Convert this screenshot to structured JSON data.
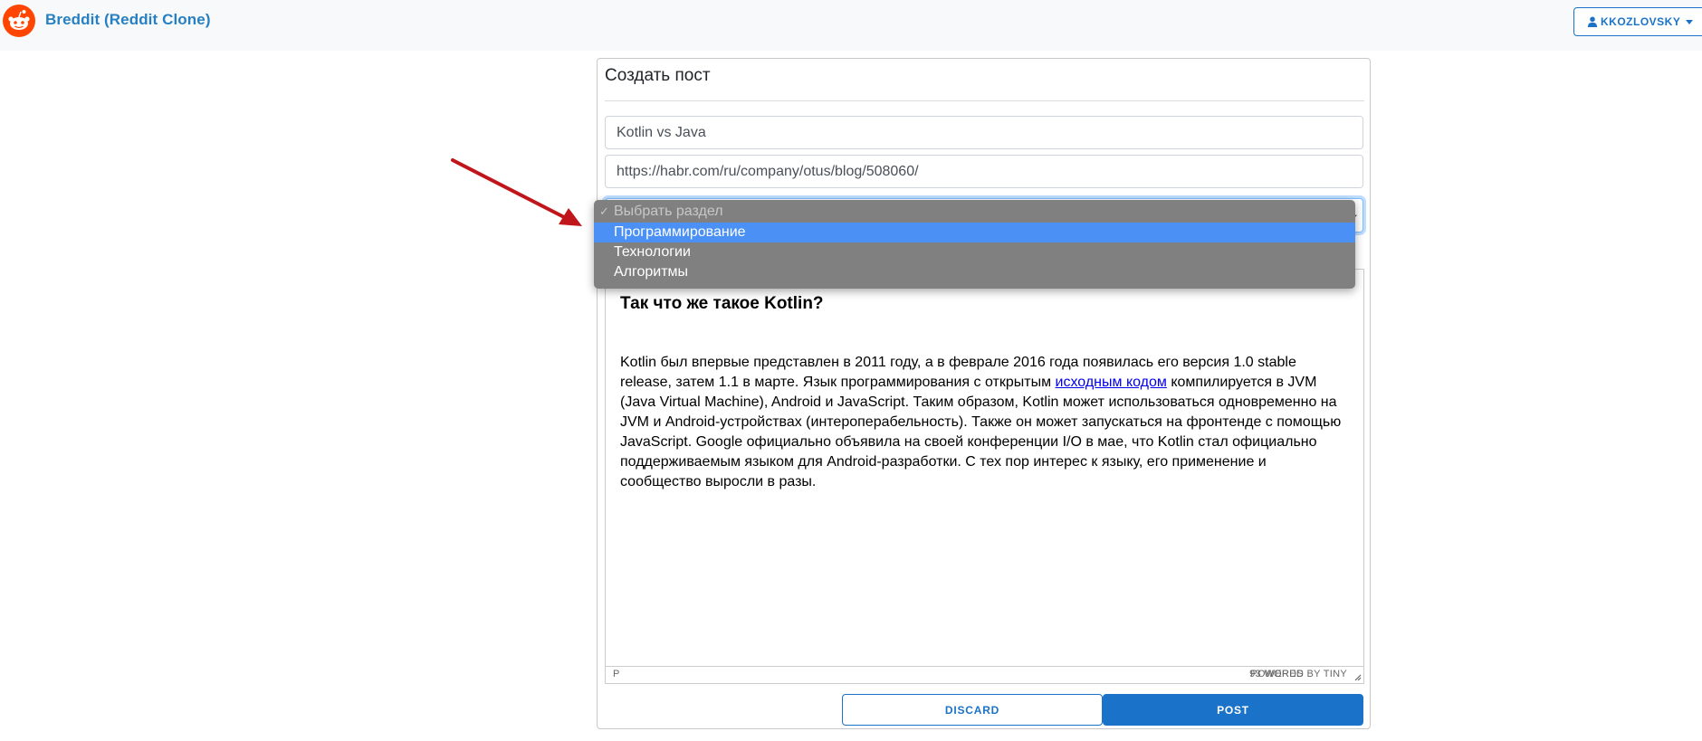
{
  "navbar": {
    "brand": "Breddit (Reddit Clone)",
    "logo_icon": "reddit-alien-icon",
    "user_menu_label": "KKOZLOVSKY",
    "user_icon": "person-icon"
  },
  "form": {
    "heading": "Создать пост",
    "title_value": "Kotlin vs Java",
    "url_value": "https://habr.com/ru/company/otus/blog/508060/",
    "subreddit_select": {
      "placeholder": "Выбрать раздел",
      "options": [
        "Программирование",
        "Технологии",
        "Алгоритмы"
      ],
      "highlighted": "Программирование"
    }
  },
  "editor": {
    "heading": "Так что же такое Kotlin?",
    "paragraph_before_link": "Kotlin был впервые представлен в 2011 году, а в феврале 2016 года появилась его версия 1.0 stable release, затем 1.1 в марте. Язык программирования с открытым ",
    "link_text": "исходным кодом",
    "paragraph_after_link": " компилируется в JVM (Java Virtual Machine), Android и JavaScript. Таким образом, Kotlin может использоваться одновременно на JVM и Android-устройствах (интероперабельность). Также он может запускаться на фронтенде с помощью JavaScript. Google официально объявила на своей конференции I/O в мае, что Kotlin стал официально поддерживаемым языком для Android-разработки. С тех пор интерес к языку, его применение и сообщество выросли в разы.",
    "status_path": "P",
    "word_count": "93 WORDS",
    "powered_by": "POWERED BY TINY"
  },
  "actions": {
    "discard_label": "DISCARD",
    "post_label": "POST"
  },
  "colors": {
    "brand": "#2680c2",
    "primary": "#1a73c9",
    "logo": "#ff4500",
    "highlight": "#4a90f5",
    "annotation_arrow": "#c0151a"
  }
}
